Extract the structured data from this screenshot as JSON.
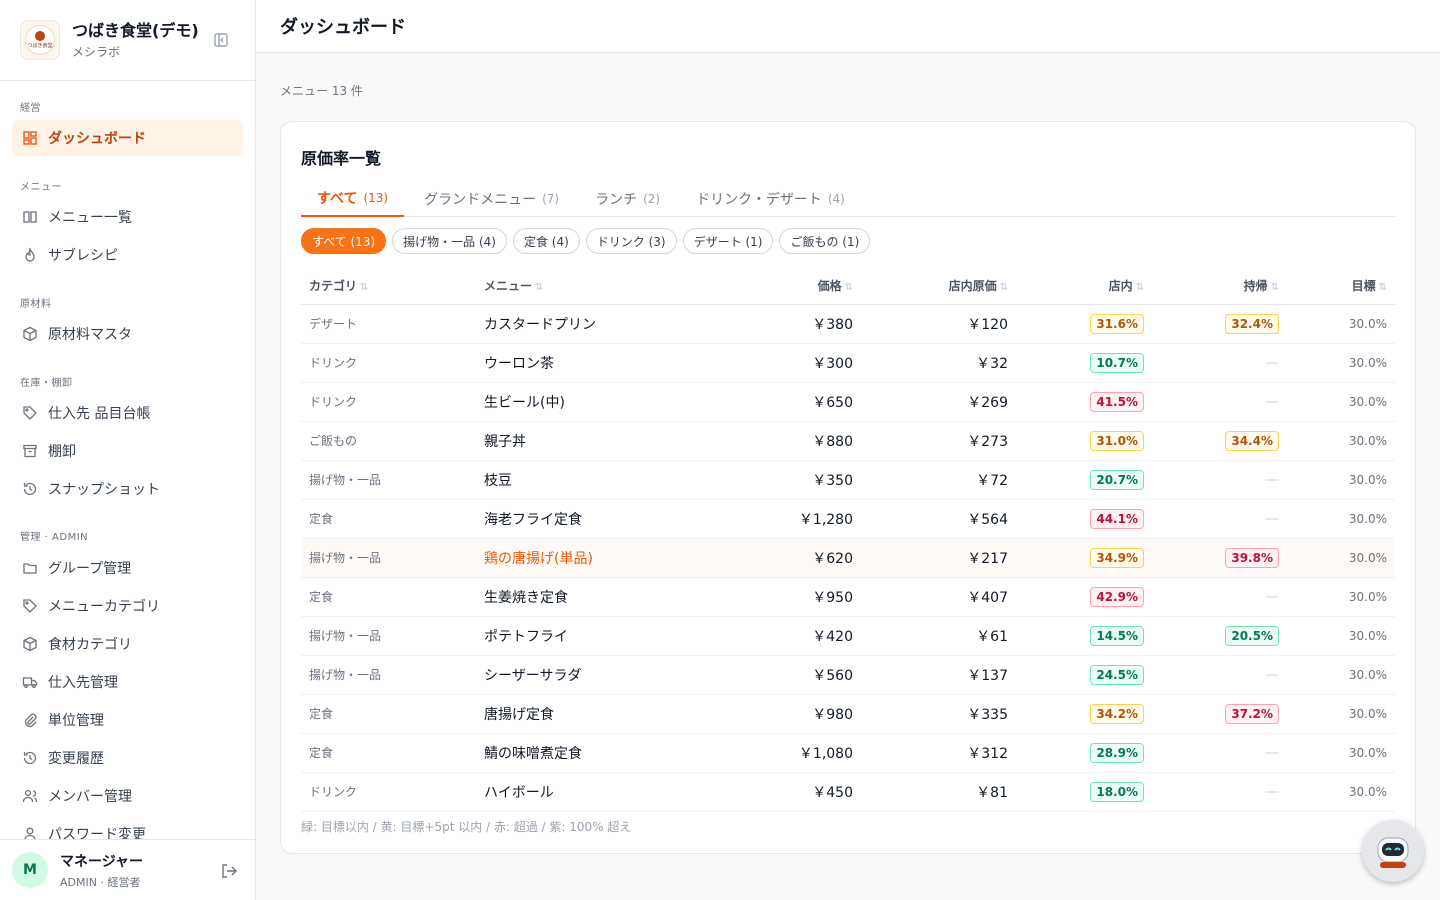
{
  "brand": {
    "title": "つばき食堂(デモ)",
    "subtitle": "メシラボ",
    "logo_text": "つばき食堂"
  },
  "sidebar": {
    "sections": [
      "経営",
      "メニュー",
      "原材料",
      "在庫・棚卸",
      "管理 · ADMIN"
    ],
    "items": [
      {
        "label": "ダッシュボード",
        "icon": "grid-icon",
        "active": true
      },
      {
        "label": "メニュー一覧",
        "icon": "book-icon"
      },
      {
        "label": "サブレシピ",
        "icon": "flame-icon"
      },
      {
        "label": "原材料マスタ",
        "icon": "box-icon"
      },
      {
        "label": "仕入先 品目台帳",
        "icon": "tag-icon"
      },
      {
        "label": "棚卸",
        "icon": "archive-icon"
      },
      {
        "label": "スナップショット",
        "icon": "history-icon"
      },
      {
        "label": "グループ管理",
        "icon": "folder-icon"
      },
      {
        "label": "メニューカテゴリ",
        "icon": "tag-icon"
      },
      {
        "label": "食材カテゴリ",
        "icon": "box-icon"
      },
      {
        "label": "仕入先管理",
        "icon": "truck-icon"
      },
      {
        "label": "単位管理",
        "icon": "paperclip-icon"
      },
      {
        "label": "変更履歴",
        "icon": "history-icon"
      },
      {
        "label": "メンバー管理",
        "icon": "users-icon"
      },
      {
        "label": "パスワード変更",
        "icon": "user-icon"
      }
    ]
  },
  "user": {
    "initial": "M",
    "name": "マネージャー",
    "role": "ADMIN · 経営者"
  },
  "header": {
    "title": "ダッシュボード"
  },
  "summary": {
    "count_text": "メニュー 13 件"
  },
  "card": {
    "title": "原価率一覧",
    "tabs": [
      {
        "label": "すべて",
        "count": "(13)",
        "active": true
      },
      {
        "label": "グランドメニュー",
        "count": "(7)"
      },
      {
        "label": "ランチ",
        "count": "(2)"
      },
      {
        "label": "ドリンク・デザート",
        "count": "(4)"
      }
    ],
    "chips": [
      {
        "label": "すべて (13)",
        "active": true
      },
      {
        "label": "揚げ物・一品 (4)"
      },
      {
        "label": "定食 (4)"
      },
      {
        "label": "ドリンク (3)"
      },
      {
        "label": "デザート (1)"
      },
      {
        "label": "ご飯もの (1)"
      }
    ],
    "columns": [
      "カテゴリ",
      "メニュー",
      "価格",
      "店内原価",
      "店内",
      "持帰",
      "目標"
    ],
    "sort_glyph": "⇅",
    "rows": [
      {
        "category": "デザート",
        "menu": "カスタードプリン",
        "price": "￥380",
        "cost": "￥120",
        "instore": "31.6%",
        "instore_level": "yellow",
        "takeout": "32.4%",
        "takeout_level": "yellow",
        "target": "30.0%"
      },
      {
        "category": "ドリンク",
        "menu": "ウーロン茶",
        "price": "￥300",
        "cost": "￥32",
        "instore": "10.7%",
        "instore_level": "green",
        "takeout": "—",
        "takeout_level": "",
        "target": "30.0%"
      },
      {
        "category": "ドリンク",
        "menu": "生ビール(中)",
        "price": "￥650",
        "cost": "￥269",
        "instore": "41.5%",
        "instore_level": "red",
        "takeout": "—",
        "takeout_level": "",
        "target": "30.0%"
      },
      {
        "category": "ご飯もの",
        "menu": "親子丼",
        "price": "￥880",
        "cost": "￥273",
        "instore": "31.0%",
        "instore_level": "yellow",
        "takeout": "34.4%",
        "takeout_level": "yellow",
        "target": "30.0%"
      },
      {
        "category": "揚げ物・一品",
        "menu": "枝豆",
        "price": "￥350",
        "cost": "￥72",
        "instore": "20.7%",
        "instore_level": "green",
        "takeout": "—",
        "takeout_level": "",
        "target": "30.0%"
      },
      {
        "category": "定食",
        "menu": "海老フライ定食",
        "price": "￥1,280",
        "cost": "￥564",
        "instore": "44.1%",
        "instore_level": "red",
        "takeout": "—",
        "takeout_level": "",
        "target": "30.0%"
      },
      {
        "category": "揚げ物・一品",
        "menu": "鶏の唐揚げ(単品)",
        "price": "￥620",
        "cost": "￥217",
        "instore": "34.9%",
        "instore_level": "yellow",
        "takeout": "39.8%",
        "takeout_level": "red",
        "target": "30.0%",
        "highlight": true
      },
      {
        "category": "定食",
        "menu": "生姜焼き定食",
        "price": "￥950",
        "cost": "￥407",
        "instore": "42.9%",
        "instore_level": "red",
        "takeout": "—",
        "takeout_level": "",
        "target": "30.0%"
      },
      {
        "category": "揚げ物・一品",
        "menu": "ポテトフライ",
        "price": "￥420",
        "cost": "￥61",
        "instore": "14.5%",
        "instore_level": "green",
        "takeout": "20.5%",
        "takeout_level": "green",
        "target": "30.0%"
      },
      {
        "category": "揚げ物・一品",
        "menu": "シーザーサラダ",
        "price": "￥560",
        "cost": "￥137",
        "instore": "24.5%",
        "instore_level": "green",
        "takeout": "—",
        "takeout_level": "",
        "target": "30.0%"
      },
      {
        "category": "定食",
        "menu": "唐揚げ定食",
        "price": "￥980",
        "cost": "￥335",
        "instore": "34.2%",
        "instore_level": "yellow",
        "takeout": "37.2%",
        "takeout_level": "red",
        "target": "30.0%"
      },
      {
        "category": "定食",
        "menu": "鯖の味噌煮定食",
        "price": "￥1,080",
        "cost": "￥312",
        "instore": "28.9%",
        "instore_level": "green",
        "takeout": "—",
        "takeout_level": "",
        "target": "30.0%"
      },
      {
        "category": "ドリンク",
        "menu": "ハイボール",
        "price": "￥450",
        "cost": "￥81",
        "instore": "18.0%",
        "instore_level": "green",
        "takeout": "—",
        "takeout_level": "",
        "target": "30.0%"
      }
    ],
    "legend": "緑: 目標以内 / 黄: 目標+5pt 以内 / 赤: 超過 / 紫: 100% 超え"
  },
  "colors": {
    "accent": "#f97316",
    "accent_text": "#ea580c",
    "green": "#047857",
    "yellow": "#b45309",
    "red": "#be123c"
  }
}
